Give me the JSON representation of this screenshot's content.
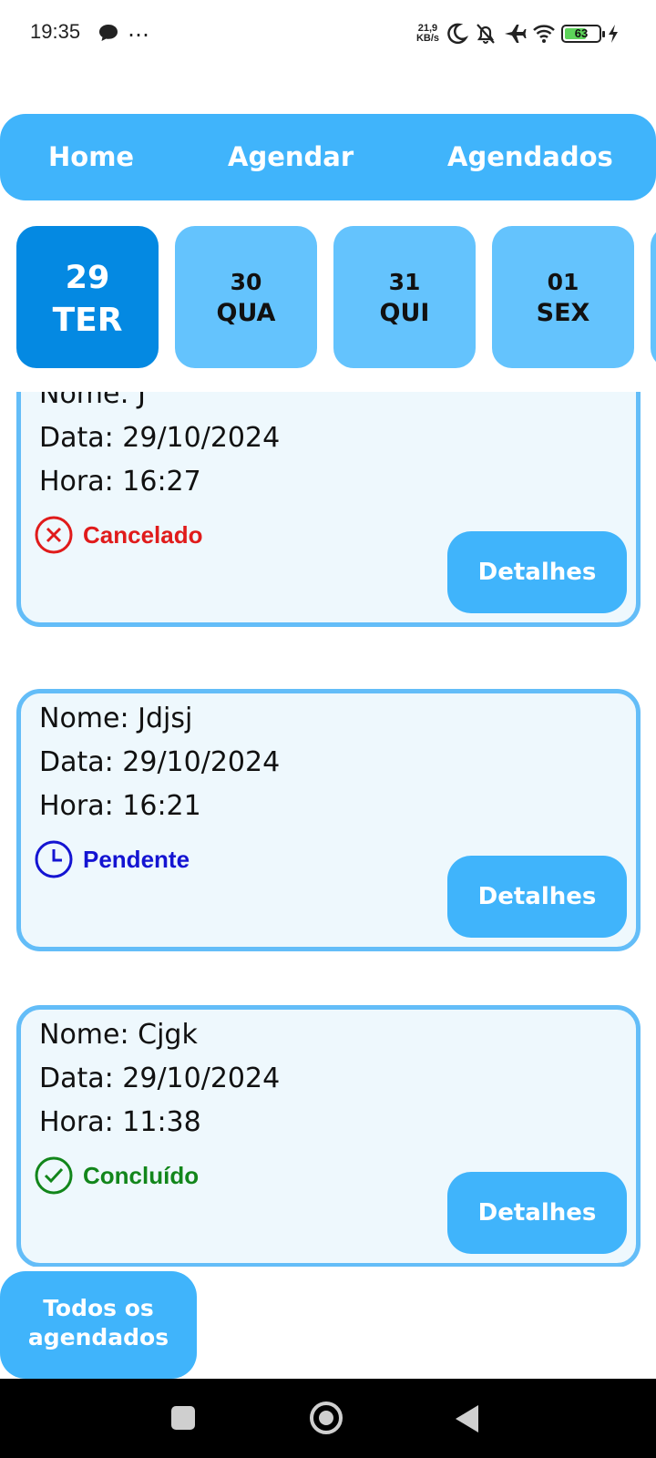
{
  "status_bar": {
    "time": "19:35",
    "dots": "…",
    "net_speed_value": "21,9",
    "net_speed_unit": "KB/s",
    "battery": "63",
    "battery_level_percent": 63
  },
  "navbar": {
    "home": "Home",
    "agendar": "Agendar",
    "agendados": "Agendados"
  },
  "dates": [
    {
      "day": "29",
      "weekday": "TER",
      "selected": true
    },
    {
      "day": "30",
      "weekday": "QUA",
      "selected": false
    },
    {
      "day": "31",
      "weekday": "QUI",
      "selected": false
    },
    {
      "day": "01",
      "weekday": "SEX",
      "selected": false
    }
  ],
  "appointments": [
    {
      "nome": "Nome: J",
      "data": "Data: 29/10/2024",
      "hora": "Hora: 16:27",
      "status": "Cancelado",
      "status_color": "#e01b1b",
      "status_icon": "x-circle-icon",
      "button": "Detalhes"
    },
    {
      "nome": "Nome: Jdjsj",
      "data": "Data: 29/10/2024",
      "hora": "Hora: 16:21",
      "status": "Pendente",
      "status_color": "#1414d2",
      "status_icon": "clock-icon",
      "button": "Detalhes"
    },
    {
      "nome": "Nome: Cjgk",
      "data": "Data: 29/10/2024",
      "hora": "Hora: 11:38",
      "status": "Concluído",
      "status_color": "#12861b",
      "status_icon": "check-circle-icon",
      "button": "Detalhes"
    }
  ],
  "todos_button": {
    "line1": "Todos os",
    "line2": "agendados"
  },
  "colors": {
    "primary": "#40b4fb",
    "selected_chip": "#0489e2",
    "chip": "#64c3fd",
    "card_bg": "#eef8fd",
    "card_border": "#63bdf8"
  }
}
